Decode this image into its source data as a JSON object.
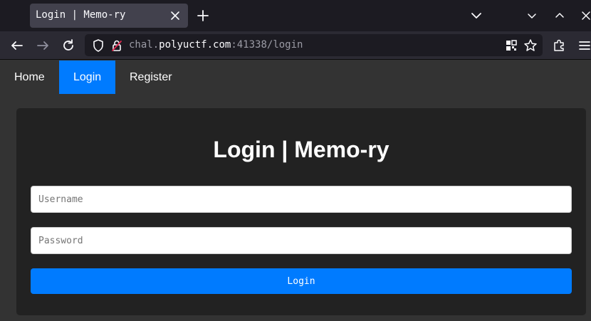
{
  "browser": {
    "tab": {
      "title": "Login | Memo-ry"
    },
    "url": {
      "prefix": "chal.",
      "host": "polyuctf.com",
      "suffix": ":41338/login"
    },
    "icons": {
      "tab_close": "close-icon",
      "new_tab": "plus-icon",
      "tabs_list": "chevron-down-icon",
      "back": "arrow-left-icon",
      "forward": "arrow-right-icon",
      "reload": "reload-icon",
      "tracking": "shield-icon",
      "security": "lock-icon",
      "qr": "qr-code-icon",
      "bookmark": "star-icon",
      "extensions": "puzzle-icon",
      "menu": "hamburger-menu-icon"
    }
  },
  "site": {
    "nav": {
      "home": "Home",
      "login": "Login",
      "register": "Register"
    },
    "card": {
      "title": "Login | Memo-ry",
      "username_placeholder": "Username",
      "password_placeholder": "Password",
      "submit_label": "Login"
    }
  },
  "colors": {
    "accent": "#007bff",
    "page_bg": "#333333",
    "card_bg": "#222222",
    "browser_chrome": "#2b2a33",
    "tabstrip": "#1c1b22"
  }
}
